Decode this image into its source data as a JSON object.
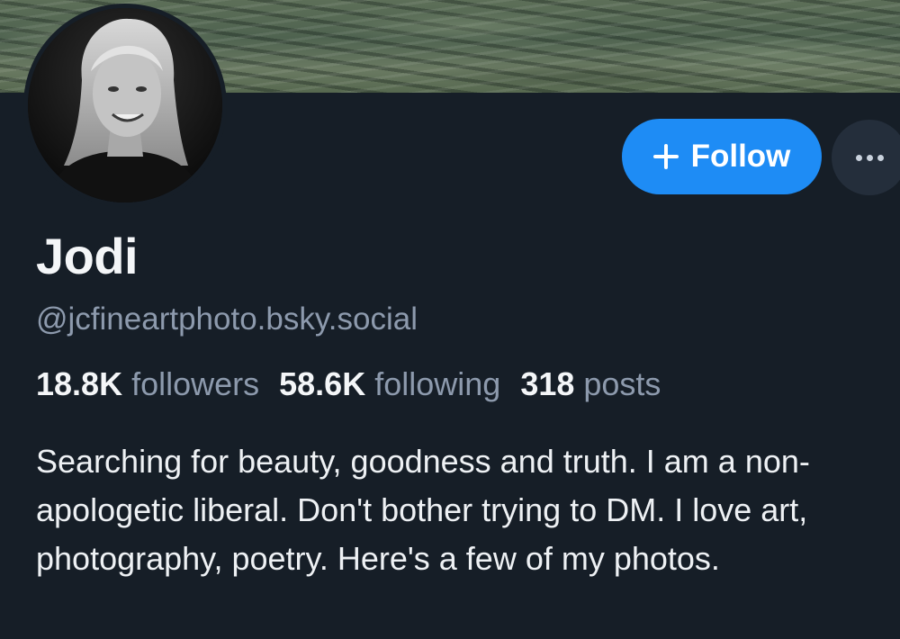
{
  "profile": {
    "display_name": "Jodi",
    "handle": "@jcfineartphoto.bsky.social",
    "bio": "Searching for beauty, goodness and truth. I am a non-apologetic liberal. Don't bother trying to DM. I love art, photography, poetry. Here's a few of my photos."
  },
  "stats": {
    "followers_count": "18.8K",
    "followers_label": "followers",
    "following_count": "58.6K",
    "following_label": "following",
    "posts_count": "318",
    "posts_label": "posts"
  },
  "actions": {
    "follow_label": "Follow",
    "follow_icon": "plus-icon",
    "more_icon": "ellipsis-icon"
  },
  "colors": {
    "background": "#161e27",
    "accent": "#1e8cf5",
    "muted_text": "#8d9aad"
  }
}
